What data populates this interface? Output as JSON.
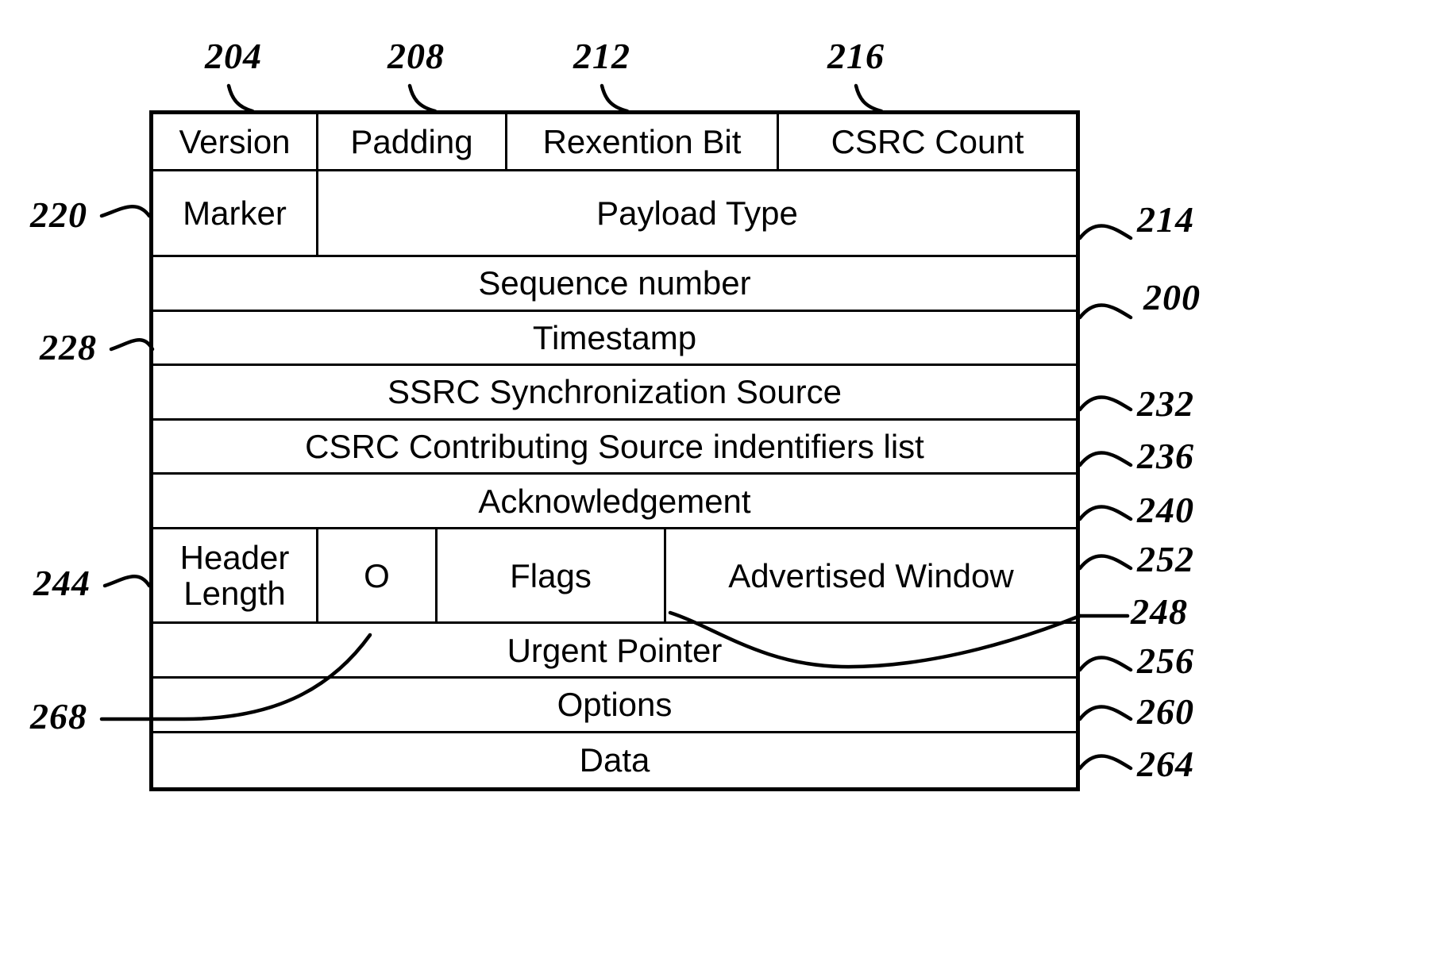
{
  "figure": {
    "kind": "packet-header-structure-diagram",
    "style": "patent-line-drawing"
  },
  "top_refs": [
    {
      "id": "204",
      "target": "Version"
    },
    {
      "id": "208",
      "target": "Padding"
    },
    {
      "id": "212",
      "target": "Rexention Bit"
    },
    {
      "id": "216",
      "target": "CSRC Count"
    }
  ],
  "left_refs": [
    {
      "id": "220",
      "target": "Marker"
    },
    {
      "id": "228",
      "target": "Timestamp"
    },
    {
      "id": "244",
      "target": "Header Length"
    },
    {
      "id": "268",
      "target": "O"
    }
  ],
  "right_refs": [
    {
      "id": "214",
      "target": "Payload Type"
    },
    {
      "id": "200",
      "target": "Sequence number"
    },
    {
      "id": "232",
      "target": "SSRC Synchronization Source"
    },
    {
      "id": "236",
      "target": "CSRC Contributing Source indentifiers list"
    },
    {
      "id": "240",
      "target": "Acknowledgement"
    },
    {
      "id": "252",
      "target": "Advertised Window"
    },
    {
      "id": "248",
      "target": "Flags boundary"
    },
    {
      "id": "256",
      "target": "Urgent Pointer"
    },
    {
      "id": "260",
      "target": "Options"
    },
    {
      "id": "264",
      "target": "Data"
    }
  ],
  "packet_rows": [
    {
      "name": "flags-row",
      "cells": [
        {
          "label": "Version"
        },
        {
          "label": "Padding"
        },
        {
          "label": "Rexention Bit"
        },
        {
          "label": "CSRC Count"
        }
      ]
    },
    {
      "name": "marker-row",
      "cells": [
        {
          "label": "Marker"
        },
        {
          "label": "Payload Type"
        }
      ]
    },
    {
      "name": "sequence-number-row",
      "cells": [
        {
          "label": "Sequence number"
        }
      ]
    },
    {
      "name": "timestamp-row",
      "cells": [
        {
          "label": "Timestamp"
        }
      ]
    },
    {
      "name": "ssrc-row",
      "cells": [
        {
          "label": "SSRC Synchronization Source"
        }
      ]
    },
    {
      "name": "csrc-row",
      "cells": [
        {
          "label": "CSRC Contributing Source indentifiers list"
        }
      ]
    },
    {
      "name": "acknowledgement-row",
      "cells": [
        {
          "label": "Acknowledgement"
        }
      ]
    },
    {
      "name": "header-length-row",
      "cells": [
        {
          "label": "Header Length"
        },
        {
          "label": "O"
        },
        {
          "label": "Flags"
        },
        {
          "label": "Advertised Window"
        }
      ]
    },
    {
      "name": "urgent-pointer-row",
      "cells": [
        {
          "label": "Urgent Pointer"
        }
      ]
    },
    {
      "name": "options-row",
      "cells": [
        {
          "label": "Options"
        }
      ]
    },
    {
      "name": "data-row",
      "cells": [
        {
          "label": "Data"
        }
      ]
    }
  ],
  "colors": {
    "ink": "#000000",
    "paper": "#ffffff"
  }
}
